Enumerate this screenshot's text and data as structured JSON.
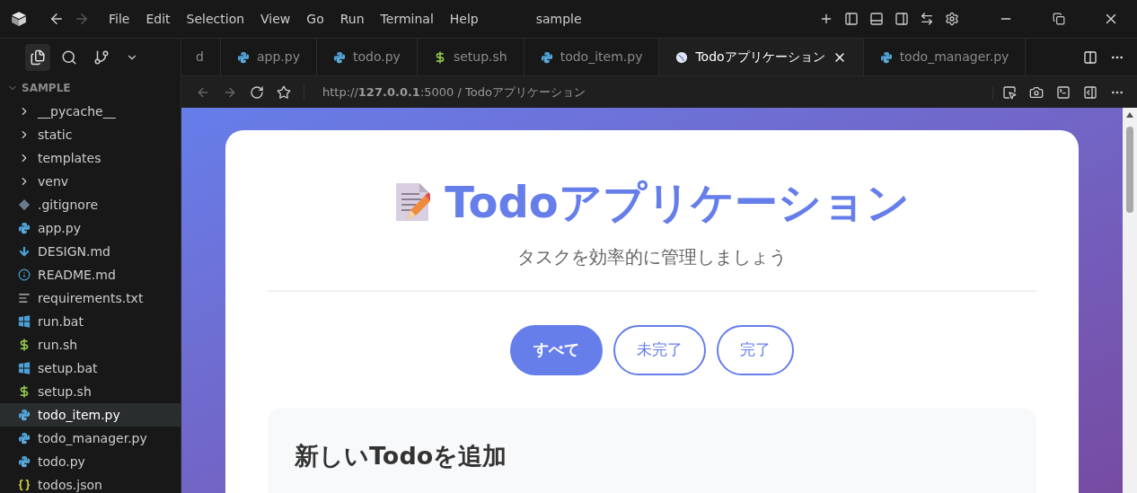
{
  "window": {
    "title": "sample"
  },
  "menu": [
    "File",
    "Edit",
    "Selection",
    "View",
    "Go",
    "Run",
    "Terminal",
    "Help"
  ],
  "explorer": {
    "title": "SAMPLE",
    "expanded": true,
    "items": [
      {
        "label": "__pycache__",
        "kind": "folder",
        "selected": false
      },
      {
        "label": "static",
        "kind": "folder",
        "selected": false
      },
      {
        "label": "templates",
        "kind": "folder",
        "selected": false
      },
      {
        "label": "venv",
        "kind": "folder",
        "selected": false
      },
      {
        "label": ".gitignore",
        "kind": "git",
        "selected": false
      },
      {
        "label": "app.py",
        "kind": "python",
        "selected": false
      },
      {
        "label": "DESIGN.md",
        "kind": "markdown",
        "selected": false
      },
      {
        "label": "README.md",
        "kind": "info",
        "selected": false
      },
      {
        "label": "requirements.txt",
        "kind": "text",
        "selected": false
      },
      {
        "label": "run.bat",
        "kind": "windows",
        "selected": false
      },
      {
        "label": "run.sh",
        "kind": "shell",
        "selected": false
      },
      {
        "label": "setup.bat",
        "kind": "windows",
        "selected": false
      },
      {
        "label": "setup.sh",
        "kind": "shell",
        "selected": false
      },
      {
        "label": "todo_item.py",
        "kind": "python",
        "selected": true
      },
      {
        "label": "todo_manager.py",
        "kind": "python",
        "selected": false
      },
      {
        "label": "todo.py",
        "kind": "python",
        "selected": false
      },
      {
        "label": "todos.json",
        "kind": "json",
        "selected": false
      }
    ]
  },
  "tabs": [
    {
      "label": "d",
      "kind": "none",
      "selected": false
    },
    {
      "label": "app.py",
      "kind": "python",
      "selected": false
    },
    {
      "label": "todo.py",
      "kind": "python",
      "selected": false
    },
    {
      "label": "setup.sh",
      "kind": "shell",
      "selected": false
    },
    {
      "label": "todo_item.py",
      "kind": "python",
      "selected": false
    },
    {
      "label": "Todoアプリケーション",
      "kind": "browser",
      "selected": true
    },
    {
      "label": "todo_manager.py",
      "kind": "python",
      "selected": false
    }
  ],
  "address": "http://**127.0.0.1**:5000 / Todoアプリケーション",
  "page": {
    "title": "Todoアプリケーション",
    "subtitle": "タスクを効率的に管理しましょう",
    "filters": [
      {
        "label": "すべて",
        "selected": true
      },
      {
        "label": "未完了",
        "selected": false
      },
      {
        "label": "完了",
        "selected": false
      }
    ],
    "section_title": "新しいTodoを追加"
  }
}
